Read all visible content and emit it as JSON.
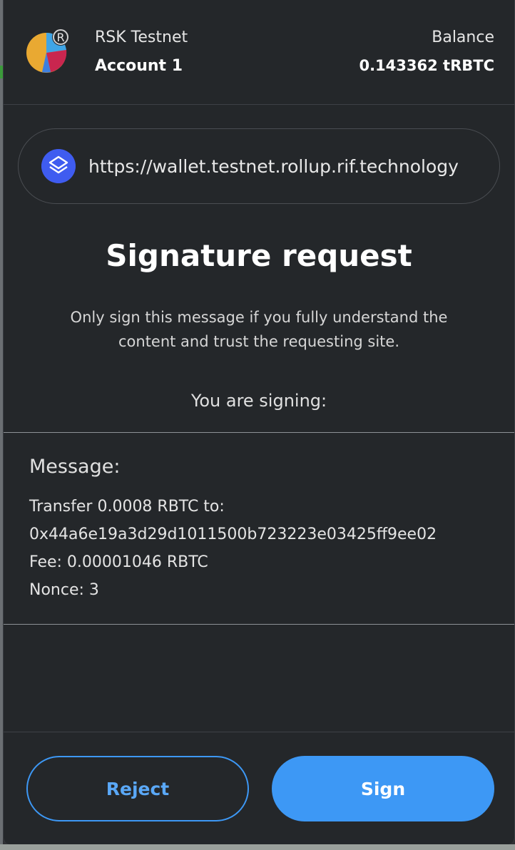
{
  "header": {
    "network": "RSK Testnet",
    "account": "Account 1",
    "balance_label": "Balance",
    "balance_value": "0.143362 tRBTC",
    "network_badge": "R"
  },
  "origin": {
    "url": "https://wallet.testnet.rollup.rif.technology",
    "icon": "layers-icon"
  },
  "title": "Signature request",
  "warning": "Only sign this message if you fully understand the content and trust the requesting site.",
  "signing_label": "You are signing:",
  "message": {
    "heading": "Message:",
    "lines": [
      "Transfer 0.0008 RBTC to:",
      "0x44a6e19a3d29d1011500b723223e03425ff9ee02",
      "Fee: 0.00001046 RBTC",
      "Nonce: 3"
    ]
  },
  "buttons": {
    "reject": "Reject",
    "sign": "Sign"
  },
  "colors": {
    "accent": "#3d98f5",
    "background": "#24272a"
  }
}
